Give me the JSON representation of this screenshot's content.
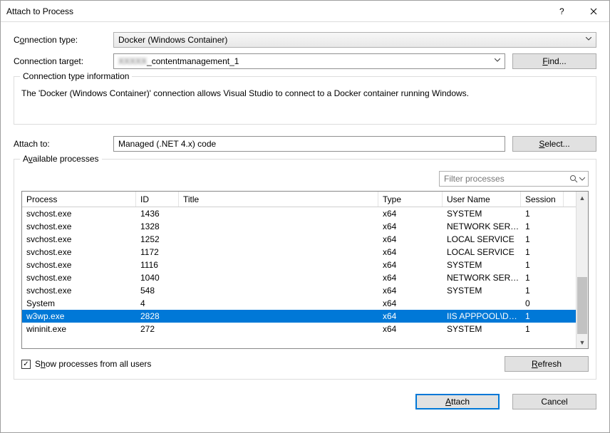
{
  "dialog": {
    "title": "Attach to Process",
    "connection_type": {
      "label_pre": "C",
      "label_u": "o",
      "label_post": "nnection type:",
      "value": "Docker (Windows Container)"
    },
    "connection_target": {
      "label": "Connection tar",
      "label_u": "g",
      "label_post": "et:",
      "value_blur": "XXXXX",
      "value": "_contentmanagement_1"
    },
    "find_btn": {
      "u": "F",
      "rest": "ind..."
    },
    "groupbox": {
      "legend": "Connection type information",
      "info": "The 'Docker (Windows Container)' connection allows Visual Studio to connect to a Docker container running Windows."
    },
    "attach_to": {
      "label": "Attach to:",
      "value": "Managed (.NET 4.x) code"
    },
    "select_btn": {
      "u": "S",
      "rest": "elect..."
    },
    "available": {
      "legend": "A",
      "legend_u": "v",
      "legend_post": "ailable processes",
      "filter_placeholder": "Filter processes",
      "columns": {
        "process": "Process",
        "id": "ID",
        "title": "Title",
        "type": "Type",
        "user": "User Name",
        "session": "Session"
      },
      "rows": [
        {
          "process": "svchost.exe",
          "id": "1436",
          "title": "",
          "type": "x64",
          "user": "SYSTEM",
          "session": "1",
          "selected": false
        },
        {
          "process": "svchost.exe",
          "id": "1328",
          "title": "",
          "type": "x64",
          "user": "NETWORK SERVICE",
          "session": "1",
          "selected": false
        },
        {
          "process": "svchost.exe",
          "id": "1252",
          "title": "",
          "type": "x64",
          "user": "LOCAL SERVICE",
          "session": "1",
          "selected": false
        },
        {
          "process": "svchost.exe",
          "id": "1172",
          "title": "",
          "type": "x64",
          "user": "LOCAL SERVICE",
          "session": "1",
          "selected": false
        },
        {
          "process": "svchost.exe",
          "id": "1116",
          "title": "",
          "type": "x64",
          "user": "SYSTEM",
          "session": "1",
          "selected": false
        },
        {
          "process": "svchost.exe",
          "id": "1040",
          "title": "",
          "type": "x64",
          "user": "NETWORK SERVICE",
          "session": "1",
          "selected": false
        },
        {
          "process": "svchost.exe",
          "id": "548",
          "title": "",
          "type": "x64",
          "user": "SYSTEM",
          "session": "1",
          "selected": false
        },
        {
          "process": "System",
          "id": "4",
          "title": "",
          "type": "x64",
          "user": "",
          "session": "0",
          "selected": false
        },
        {
          "process": "w3wp.exe",
          "id": "2828",
          "title": "",
          "type": "x64",
          "user": "IIS APPPOOL\\Default...",
          "session": "1",
          "selected": true
        },
        {
          "process": "wininit.exe",
          "id": "272",
          "title": "",
          "type": "x64",
          "user": "SYSTEM",
          "session": "1",
          "selected": false
        }
      ],
      "show_all": {
        "pre": "S",
        "u": "h",
        "post": "ow processes from all users",
        "checked": true
      },
      "refresh": {
        "u": "R",
        "rest": "efresh"
      }
    },
    "attach_btn": {
      "u": "A",
      "rest": "ttach"
    },
    "cancel_btn": "Cancel"
  }
}
